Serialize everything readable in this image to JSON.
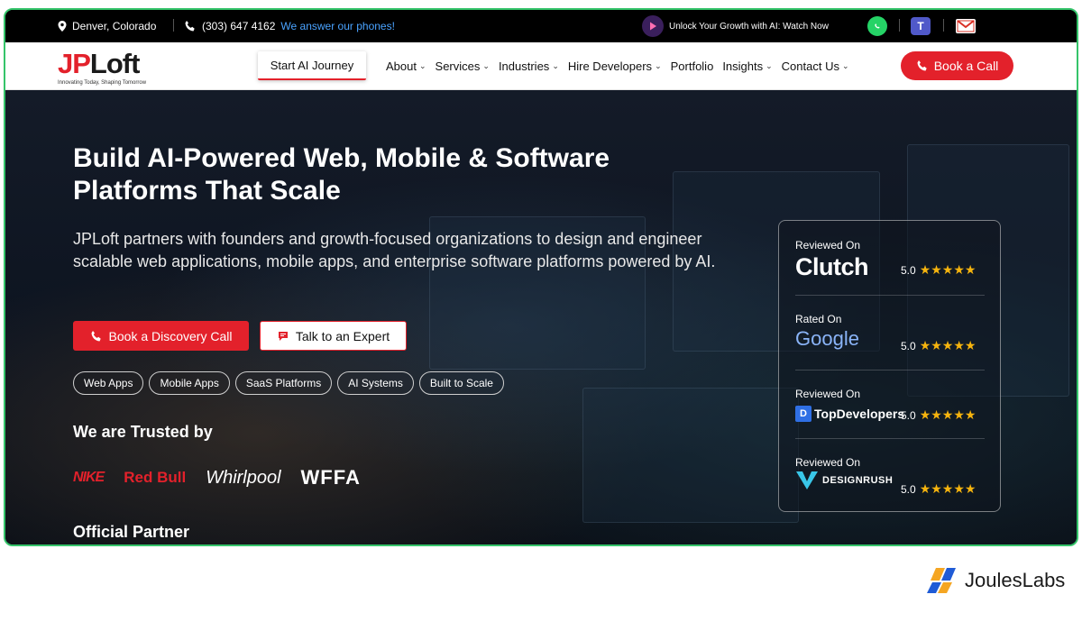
{
  "topbar": {
    "location": "Denver, Colorado",
    "phone": "(303) 647 4162",
    "answer": "We answer our phones!",
    "promo": "Unlock Your Growth with AI: Watch Now"
  },
  "nav": {
    "logo_main_a": "JP",
    "logo_main_b": "Loft",
    "logo_tagline": "Innovating Today, Shaping Tomorrow",
    "start_ai": "Start AI Journey",
    "links": [
      "About",
      "Services",
      "Industries",
      "Hire Developers",
      "Portfolio",
      "Insights",
      "Contact Us"
    ],
    "cta": "Book a Call"
  },
  "hero": {
    "title": "Build AI-Powered Web, Mobile & Software Platforms That Scale",
    "subtitle": "JPLoft partners with founders and growth-focused organizations to design and engineer scalable web applications, mobile apps, and enterprise software platforms powered by AI.",
    "primary_button": "Book a Discovery Call",
    "secondary_button": "Talk to an Expert",
    "chips": [
      "Web Apps",
      "Mobile Apps",
      "SaaS Platforms",
      "AI Systems",
      "Built to Scale"
    ],
    "trusted_title": "We are Trusted by",
    "brands": [
      "NIKE",
      "Red Bull",
      "Whirlpool",
      "WFFA"
    ],
    "partner_title": "Official Partner"
  },
  "reviews": [
    {
      "label": "Reviewed On",
      "platform": "Clutch",
      "score": "5.0",
      "stars": "★★★★★"
    },
    {
      "label": "Rated On",
      "platform": "Google",
      "score": "5.0",
      "stars": "★★★★★"
    },
    {
      "label": "Reviewed On",
      "platform": "TopDevelopers",
      "score": "5.0",
      "stars": "★★★★★"
    },
    {
      "label": "Reviewed On",
      "platform": "DESIGNRUSH",
      "score": "5.0",
      "stars": "★★★★★"
    }
  ],
  "watermark": {
    "text": "JoulesLabs"
  },
  "colors": {
    "brand_red": "#e3212b",
    "frame_green": "#35c46a",
    "star": "#f6b40e"
  }
}
